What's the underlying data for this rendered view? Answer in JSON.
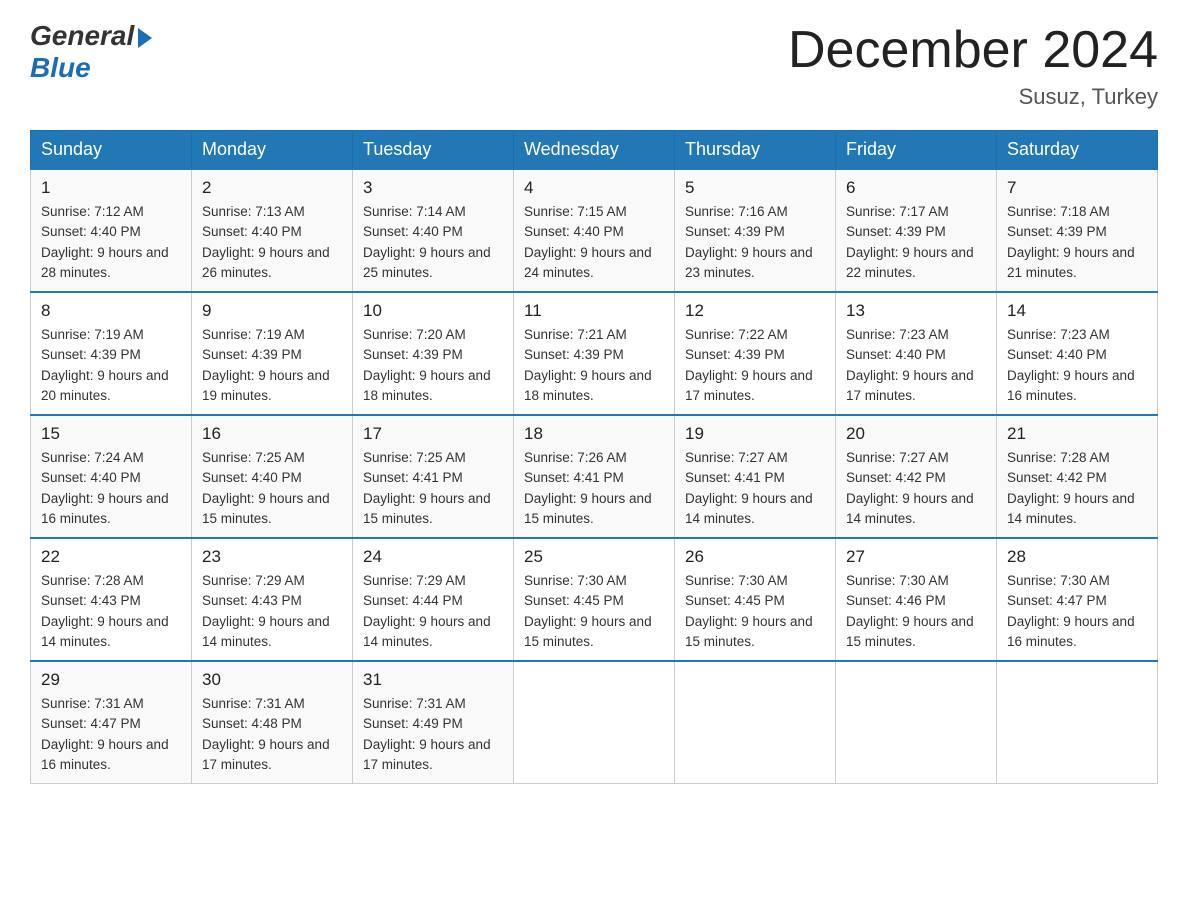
{
  "header": {
    "logo_general": "General",
    "logo_blue": "Blue",
    "month_title": "December 2024",
    "location": "Susuz, Turkey"
  },
  "days_of_week": [
    "Sunday",
    "Monday",
    "Tuesday",
    "Wednesday",
    "Thursday",
    "Friday",
    "Saturday"
  ],
  "weeks": [
    [
      {
        "day": "1",
        "sunrise": "7:12 AM",
        "sunset": "4:40 PM",
        "daylight": "9 hours and 28 minutes."
      },
      {
        "day": "2",
        "sunrise": "7:13 AM",
        "sunset": "4:40 PM",
        "daylight": "9 hours and 26 minutes."
      },
      {
        "day": "3",
        "sunrise": "7:14 AM",
        "sunset": "4:40 PM",
        "daylight": "9 hours and 25 minutes."
      },
      {
        "day": "4",
        "sunrise": "7:15 AM",
        "sunset": "4:40 PM",
        "daylight": "9 hours and 24 minutes."
      },
      {
        "day": "5",
        "sunrise": "7:16 AM",
        "sunset": "4:39 PM",
        "daylight": "9 hours and 23 minutes."
      },
      {
        "day": "6",
        "sunrise": "7:17 AM",
        "sunset": "4:39 PM",
        "daylight": "9 hours and 22 minutes."
      },
      {
        "day": "7",
        "sunrise": "7:18 AM",
        "sunset": "4:39 PM",
        "daylight": "9 hours and 21 minutes."
      }
    ],
    [
      {
        "day": "8",
        "sunrise": "7:19 AM",
        "sunset": "4:39 PM",
        "daylight": "9 hours and 20 minutes."
      },
      {
        "day": "9",
        "sunrise": "7:19 AM",
        "sunset": "4:39 PM",
        "daylight": "9 hours and 19 minutes."
      },
      {
        "day": "10",
        "sunrise": "7:20 AM",
        "sunset": "4:39 PM",
        "daylight": "9 hours and 18 minutes."
      },
      {
        "day": "11",
        "sunrise": "7:21 AM",
        "sunset": "4:39 PM",
        "daylight": "9 hours and 18 minutes."
      },
      {
        "day": "12",
        "sunrise": "7:22 AM",
        "sunset": "4:39 PM",
        "daylight": "9 hours and 17 minutes."
      },
      {
        "day": "13",
        "sunrise": "7:23 AM",
        "sunset": "4:40 PM",
        "daylight": "9 hours and 17 minutes."
      },
      {
        "day": "14",
        "sunrise": "7:23 AM",
        "sunset": "4:40 PM",
        "daylight": "9 hours and 16 minutes."
      }
    ],
    [
      {
        "day": "15",
        "sunrise": "7:24 AM",
        "sunset": "4:40 PM",
        "daylight": "9 hours and 16 minutes."
      },
      {
        "day": "16",
        "sunrise": "7:25 AM",
        "sunset": "4:40 PM",
        "daylight": "9 hours and 15 minutes."
      },
      {
        "day": "17",
        "sunrise": "7:25 AM",
        "sunset": "4:41 PM",
        "daylight": "9 hours and 15 minutes."
      },
      {
        "day": "18",
        "sunrise": "7:26 AM",
        "sunset": "4:41 PM",
        "daylight": "9 hours and 15 minutes."
      },
      {
        "day": "19",
        "sunrise": "7:27 AM",
        "sunset": "4:41 PM",
        "daylight": "9 hours and 14 minutes."
      },
      {
        "day": "20",
        "sunrise": "7:27 AM",
        "sunset": "4:42 PM",
        "daylight": "9 hours and 14 minutes."
      },
      {
        "day": "21",
        "sunrise": "7:28 AM",
        "sunset": "4:42 PM",
        "daylight": "9 hours and 14 minutes."
      }
    ],
    [
      {
        "day": "22",
        "sunrise": "7:28 AM",
        "sunset": "4:43 PM",
        "daylight": "9 hours and 14 minutes."
      },
      {
        "day": "23",
        "sunrise": "7:29 AM",
        "sunset": "4:43 PM",
        "daylight": "9 hours and 14 minutes."
      },
      {
        "day": "24",
        "sunrise": "7:29 AM",
        "sunset": "4:44 PM",
        "daylight": "9 hours and 14 minutes."
      },
      {
        "day": "25",
        "sunrise": "7:30 AM",
        "sunset": "4:45 PM",
        "daylight": "9 hours and 15 minutes."
      },
      {
        "day": "26",
        "sunrise": "7:30 AM",
        "sunset": "4:45 PM",
        "daylight": "9 hours and 15 minutes."
      },
      {
        "day": "27",
        "sunrise": "7:30 AM",
        "sunset": "4:46 PM",
        "daylight": "9 hours and 15 minutes."
      },
      {
        "day": "28",
        "sunrise": "7:30 AM",
        "sunset": "4:47 PM",
        "daylight": "9 hours and 16 minutes."
      }
    ],
    [
      {
        "day": "29",
        "sunrise": "7:31 AM",
        "sunset": "4:47 PM",
        "daylight": "9 hours and 16 minutes."
      },
      {
        "day": "30",
        "sunrise": "7:31 AM",
        "sunset": "4:48 PM",
        "daylight": "9 hours and 17 minutes."
      },
      {
        "day": "31",
        "sunrise": "7:31 AM",
        "sunset": "4:49 PM",
        "daylight": "9 hours and 17 minutes."
      },
      null,
      null,
      null,
      null
    ]
  ]
}
